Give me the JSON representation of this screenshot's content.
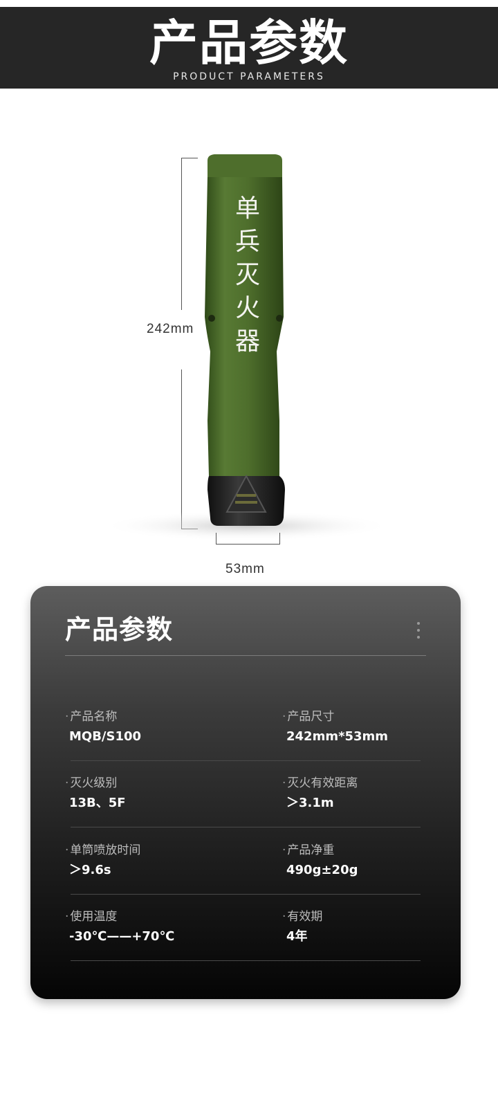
{
  "header": {
    "title": "产品参数",
    "subtitle": "PRODUCT PARAMETERS"
  },
  "product": {
    "label": "单兵灭火器",
    "height_label": "242mm",
    "width_label": "53mm",
    "body_color": "#4f6e2f",
    "base_color": "#1f1f1f"
  },
  "card": {
    "title": "产品参数",
    "params": [
      {
        "label": "产品名称",
        "value": "MQB/S100"
      },
      {
        "label": "产品尺寸",
        "value": "242mm*53mm"
      },
      {
        "label": "灭火级别",
        "value": "13B、5F"
      },
      {
        "label": "灭火有效距离",
        "value": "＞3.1m"
      },
      {
        "label": "单筒喷放时间",
        "value": "＞9.6s"
      },
      {
        "label": "产品净重",
        "value": "490g±20g"
      },
      {
        "label": "使用温度",
        "value": "-30℃——+70℃"
      },
      {
        "label": "有效期",
        "value": "4年"
      }
    ]
  }
}
